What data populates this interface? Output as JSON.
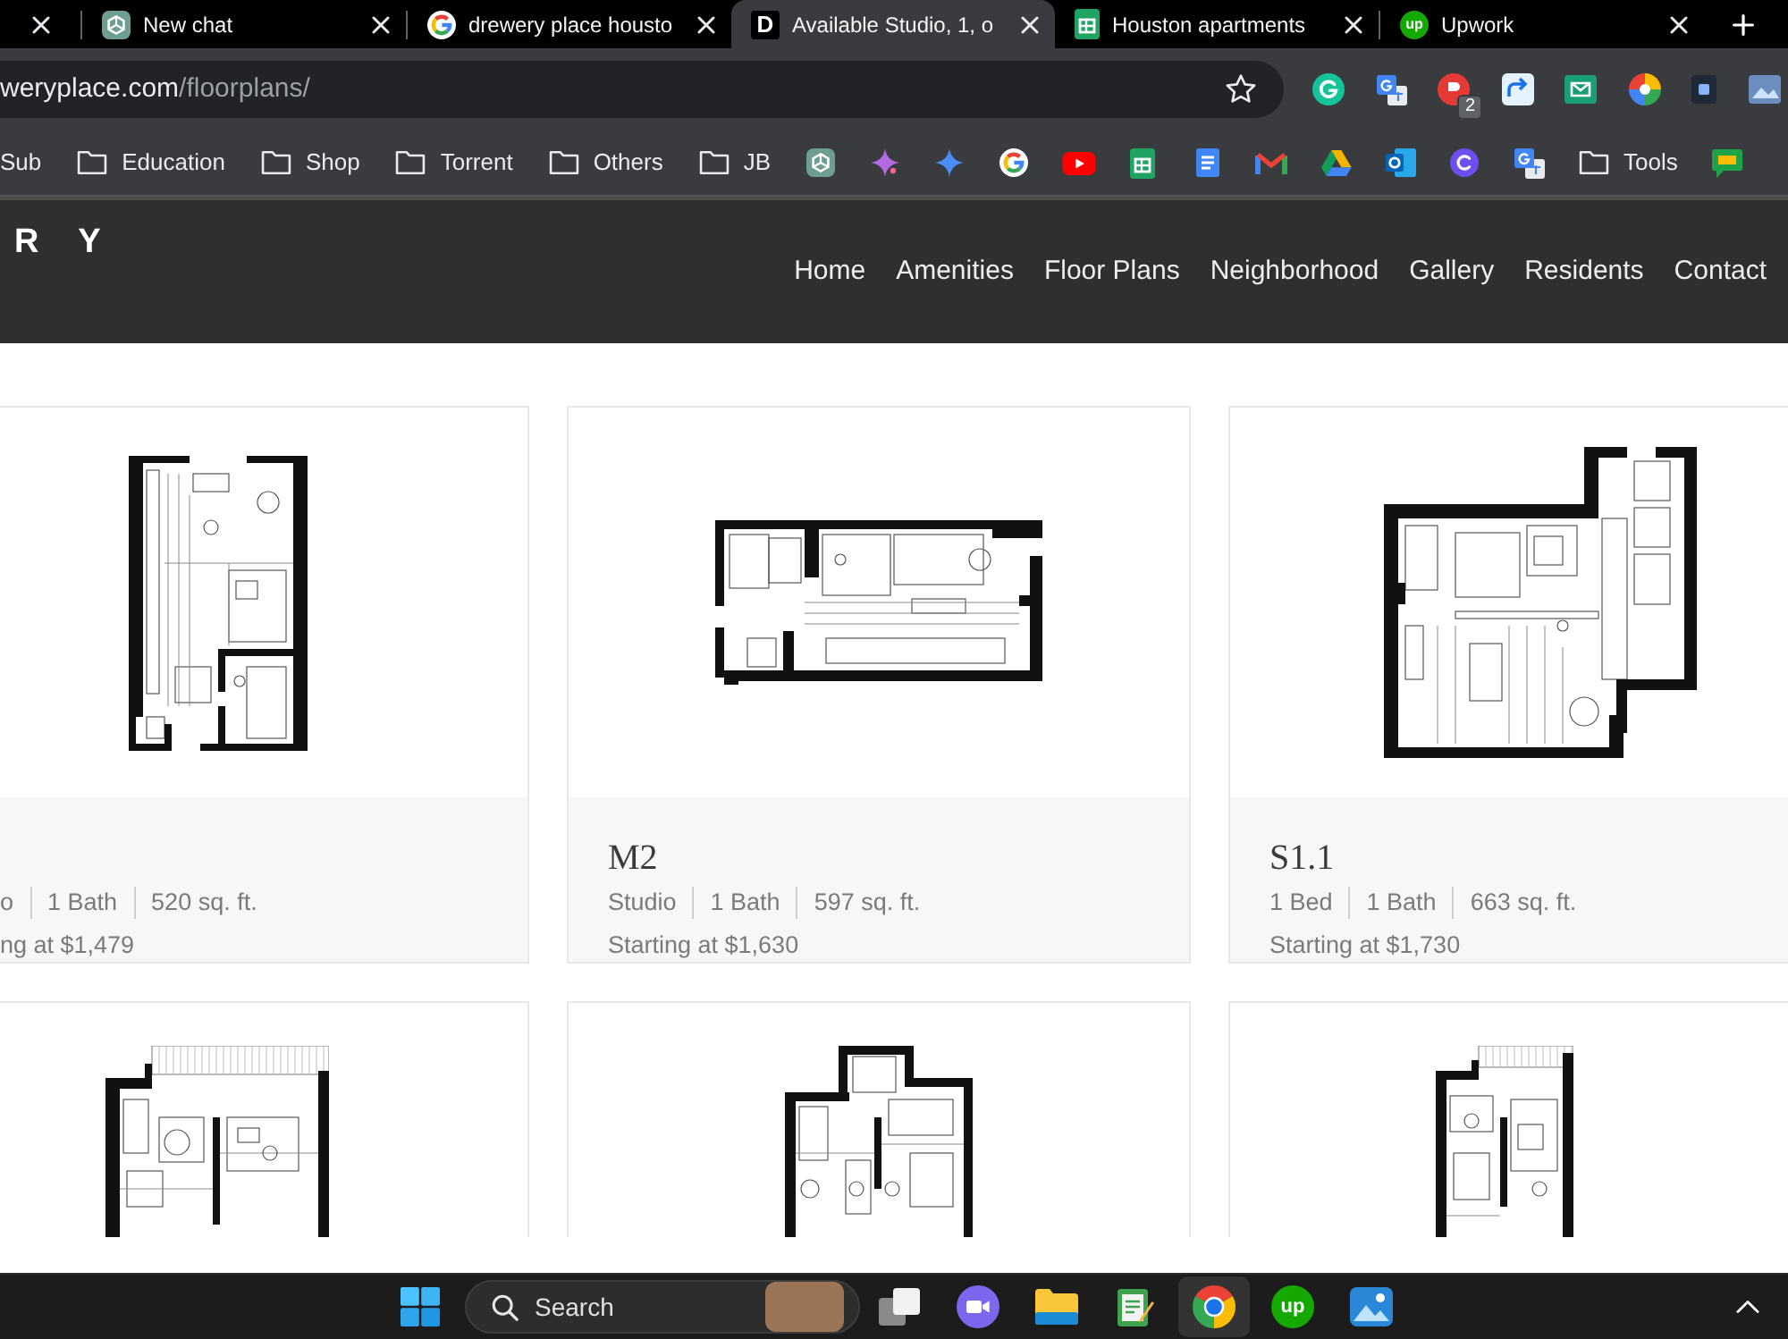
{
  "browser": {
    "tabs": [
      {
        "selected": false
      },
      {
        "title": "New chat",
        "selected": false
      },
      {
        "title": "drewery place housto",
        "selected": false
      },
      {
        "title": "Available Studio, 1, o",
        "icon_text": "D",
        "selected": true
      },
      {
        "title": "Houston apartments",
        "selected": false
      },
      {
        "title": "Upwork",
        "icon_text": "up",
        "selected": false
      }
    ],
    "address_bar": {
      "host": "weryplace.com",
      "path": "/floorplans/"
    },
    "extension_badge": "2",
    "bookmarks": [
      {
        "kind": "link",
        "label": "Sub"
      },
      {
        "kind": "folder",
        "label": "Education"
      },
      {
        "kind": "folder",
        "label": "Shop"
      },
      {
        "kind": "folder",
        "label": "Torrent"
      },
      {
        "kind": "folder",
        "label": "Others"
      },
      {
        "kind": "folder",
        "label": "JB"
      },
      {
        "kind": "icon"
      },
      {
        "kind": "icon"
      },
      {
        "kind": "icon"
      },
      {
        "kind": "icon"
      },
      {
        "kind": "icon"
      },
      {
        "kind": "icon"
      },
      {
        "kind": "icon"
      },
      {
        "kind": "icon"
      },
      {
        "kind": "icon"
      },
      {
        "kind": "icon"
      },
      {
        "kind": "icon"
      },
      {
        "kind": "icon"
      },
      {
        "kind": "folder",
        "label": "Tools"
      },
      {
        "kind": "icon"
      }
    ]
  },
  "site": {
    "logo": "R Y",
    "nav": [
      "Home",
      "Amenities",
      "Floor Plans",
      "Neighborhood",
      "Gallery",
      "Residents",
      "Contact"
    ],
    "floorplans": [
      {
        "kind": "full",
        "specs": [
          "o",
          "1 Bath",
          "520 sq. ft."
        ],
        "price": "ng at $1,479"
      },
      {
        "kind": "full",
        "name": "M2",
        "specs": [
          "Studio",
          "1 Bath",
          "597 sq. ft."
        ],
        "price": "Starting at $1,630"
      },
      {
        "kind": "full",
        "name": "S1.1",
        "specs": [
          "1 Bed",
          "1 Bath",
          "663 sq. ft."
        ],
        "price": "Starting at $1,730"
      },
      {
        "kind": "plan_only"
      },
      {
        "kind": "plan_only"
      },
      {
        "kind": "plan_only"
      }
    ]
  },
  "taskbar": {
    "search": {
      "label": "Search"
    },
    "apps": [
      {
        "selected": false
      },
      {
        "selected": false
      },
      {
        "selected": false
      },
      {
        "selected": false
      },
      {
        "selected": true
      },
      {
        "icon_text": "up",
        "selected": false
      },
      {
        "selected": false
      }
    ]
  }
}
